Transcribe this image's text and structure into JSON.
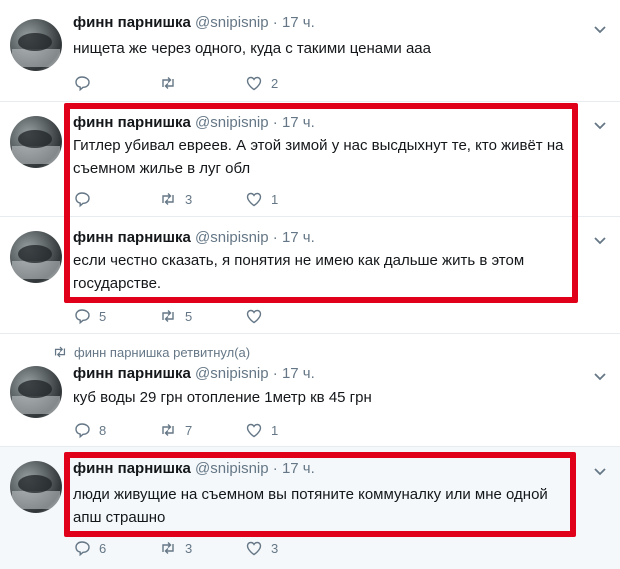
{
  "tweets": [
    {
      "name": "финн парнишка",
      "handle": "@snipisnip",
      "dot": "·",
      "time": "17 ч.",
      "text": "нищета же через одного, куда с такими ценами ааа",
      "replies": "",
      "retweets": "",
      "likes": "2"
    },
    {
      "name": "финн парнишка",
      "handle": "@snipisnip",
      "dot": "·",
      "time": "17 ч.",
      "text": "Гитлер убивал евреев. А этой зимой у нас высдыхнут те, кто живёт на съемном жилье в луг обл",
      "replies": "",
      "retweets": "3",
      "likes": "1"
    },
    {
      "name": "финн парнишка",
      "handle": "@snipisnip",
      "dot": "·",
      "time": "17 ч.",
      "text": "если честно сказать, я понятия не имею как дальше жить в этом государстве.",
      "replies": "5",
      "retweets": "5",
      "likes": ""
    },
    {
      "retweeted_by": "финн парнишка ретвитнул(а)",
      "name": "финн парнишка",
      "handle": "@snipisnip",
      "dot": "·",
      "time": "17 ч.",
      "text": "куб воды 29 грн  отопление 1метр кв  45 грн",
      "replies": "8",
      "retweets": "7",
      "likes": "1"
    },
    {
      "name": "финн парнишка",
      "handle": "@snipisnip",
      "dot": "·",
      "time": "17 ч.",
      "text": "люди живущие на съемном вы потяните коммуналку или мне одной апш страшно",
      "replies": "6",
      "retweets": "3",
      "likes": "3"
    }
  ],
  "icons": {
    "reply": "reply-icon",
    "retweet": "retweet-icon",
    "like": "heart-icon",
    "menu": "chevron-down-icon"
  },
  "colors": {
    "highlight": "#e0001a",
    "muted": "#657786",
    "shaded_bg": "#f5f8fa"
  }
}
